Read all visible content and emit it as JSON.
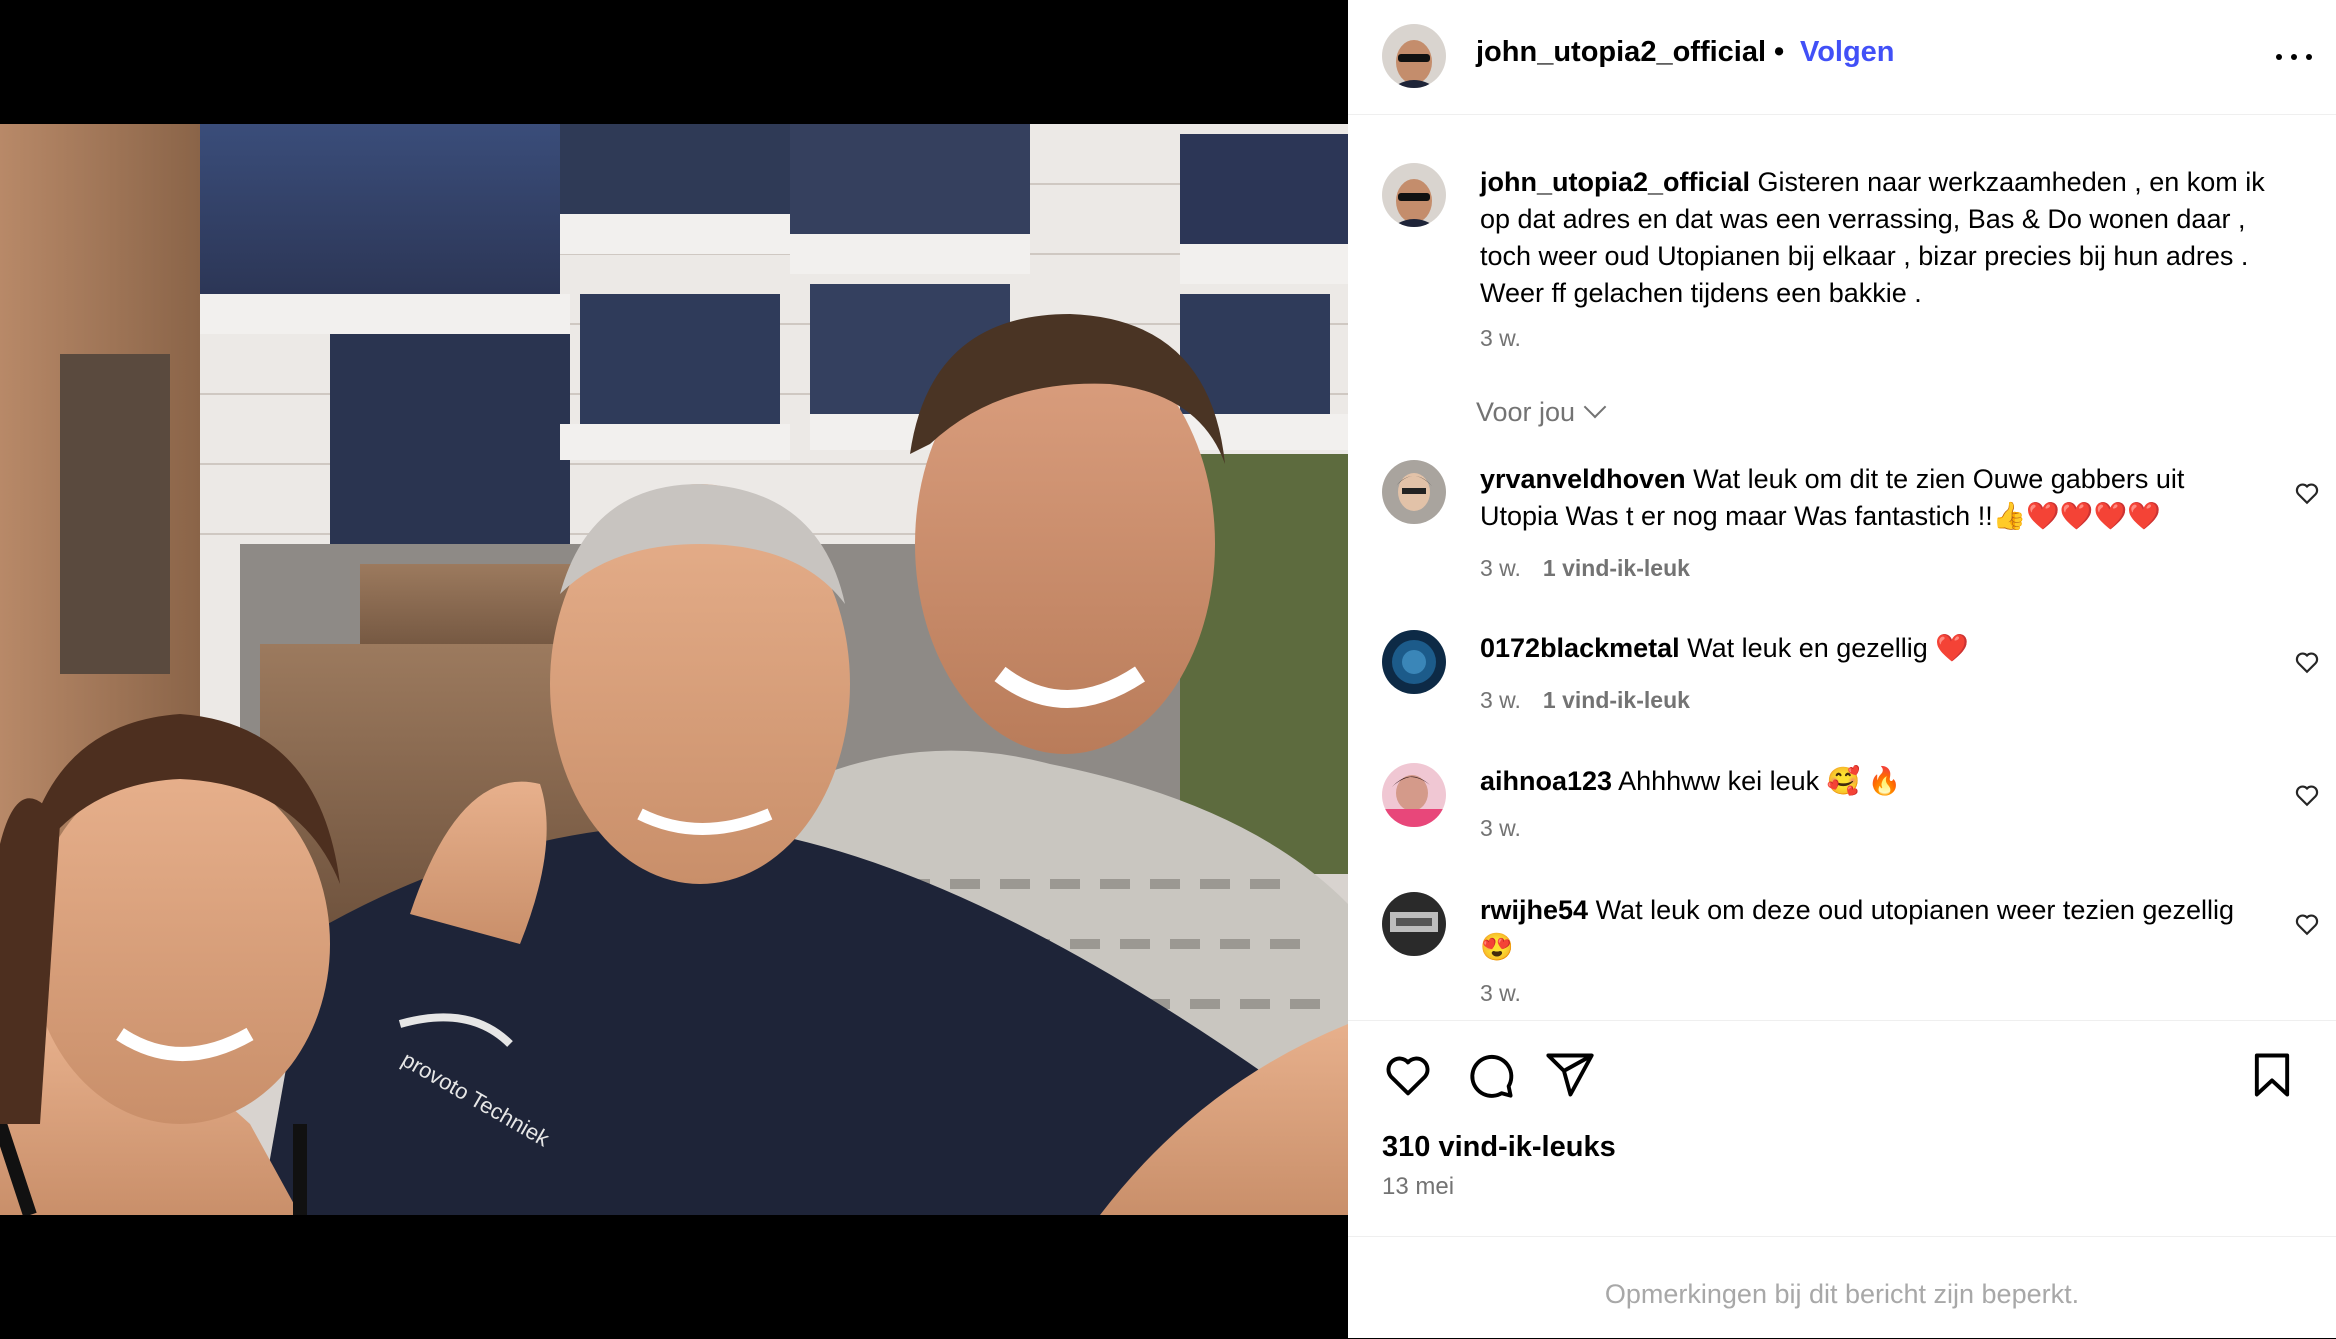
{
  "post": {
    "username": "john_utopia2_official",
    "separator": "•",
    "follow_label": "Volgen",
    "caption": "Gisteren naar werkzaamheden , en kom ik op dat adres en dat was een verrassing, Bas & Do wonen daar , toch weer oud Utopianen bij elkaar , bizar precies bij hun adres . Weer ff gelachen tijdens een bakkie .",
    "caption_time": "3 w.",
    "for_you_label": "Voor jou",
    "likes": "310 vind-ik-leuks",
    "date": "13 mei",
    "restricted_notice": "Opmerkingen bij dit bericht zijn beperkt.",
    "photo_text": "provoto Techniek"
  },
  "comments": [
    {
      "username": "yrvanveldhoven",
      "text": "Wat leuk om dit te zien Ouwe gabbers uit Utopia Was t er nog maar Was fantastich !!👍❤️❤️❤️❤️",
      "time": "3 w.",
      "likes": "1 vind-ik-leuk"
    },
    {
      "username": "0172blackmetal",
      "text": "Wat leuk en gezellig ❤️",
      "time": "3 w.",
      "likes": "1 vind-ik-leuk"
    },
    {
      "username": "aihnoa123",
      "text": "Ahhhww kei leuk 🥰 🔥",
      "time": "3 w.",
      "likes": ""
    },
    {
      "username": "rwijhe54",
      "text": "Wat leuk om deze oud utopianen weer tezien gezellig 😍",
      "time": "3 w.",
      "likes": ""
    }
  ],
  "icons": {
    "more": "more-options-icon",
    "like": "heart-icon",
    "comment": "comment-icon",
    "share": "share-icon",
    "save": "bookmark-icon"
  },
  "colors": {
    "accent": "#4150f7",
    "secondary_text": "#737373",
    "muted_text": "#a8a8a8",
    "emoji_heart": "#e0245e"
  }
}
